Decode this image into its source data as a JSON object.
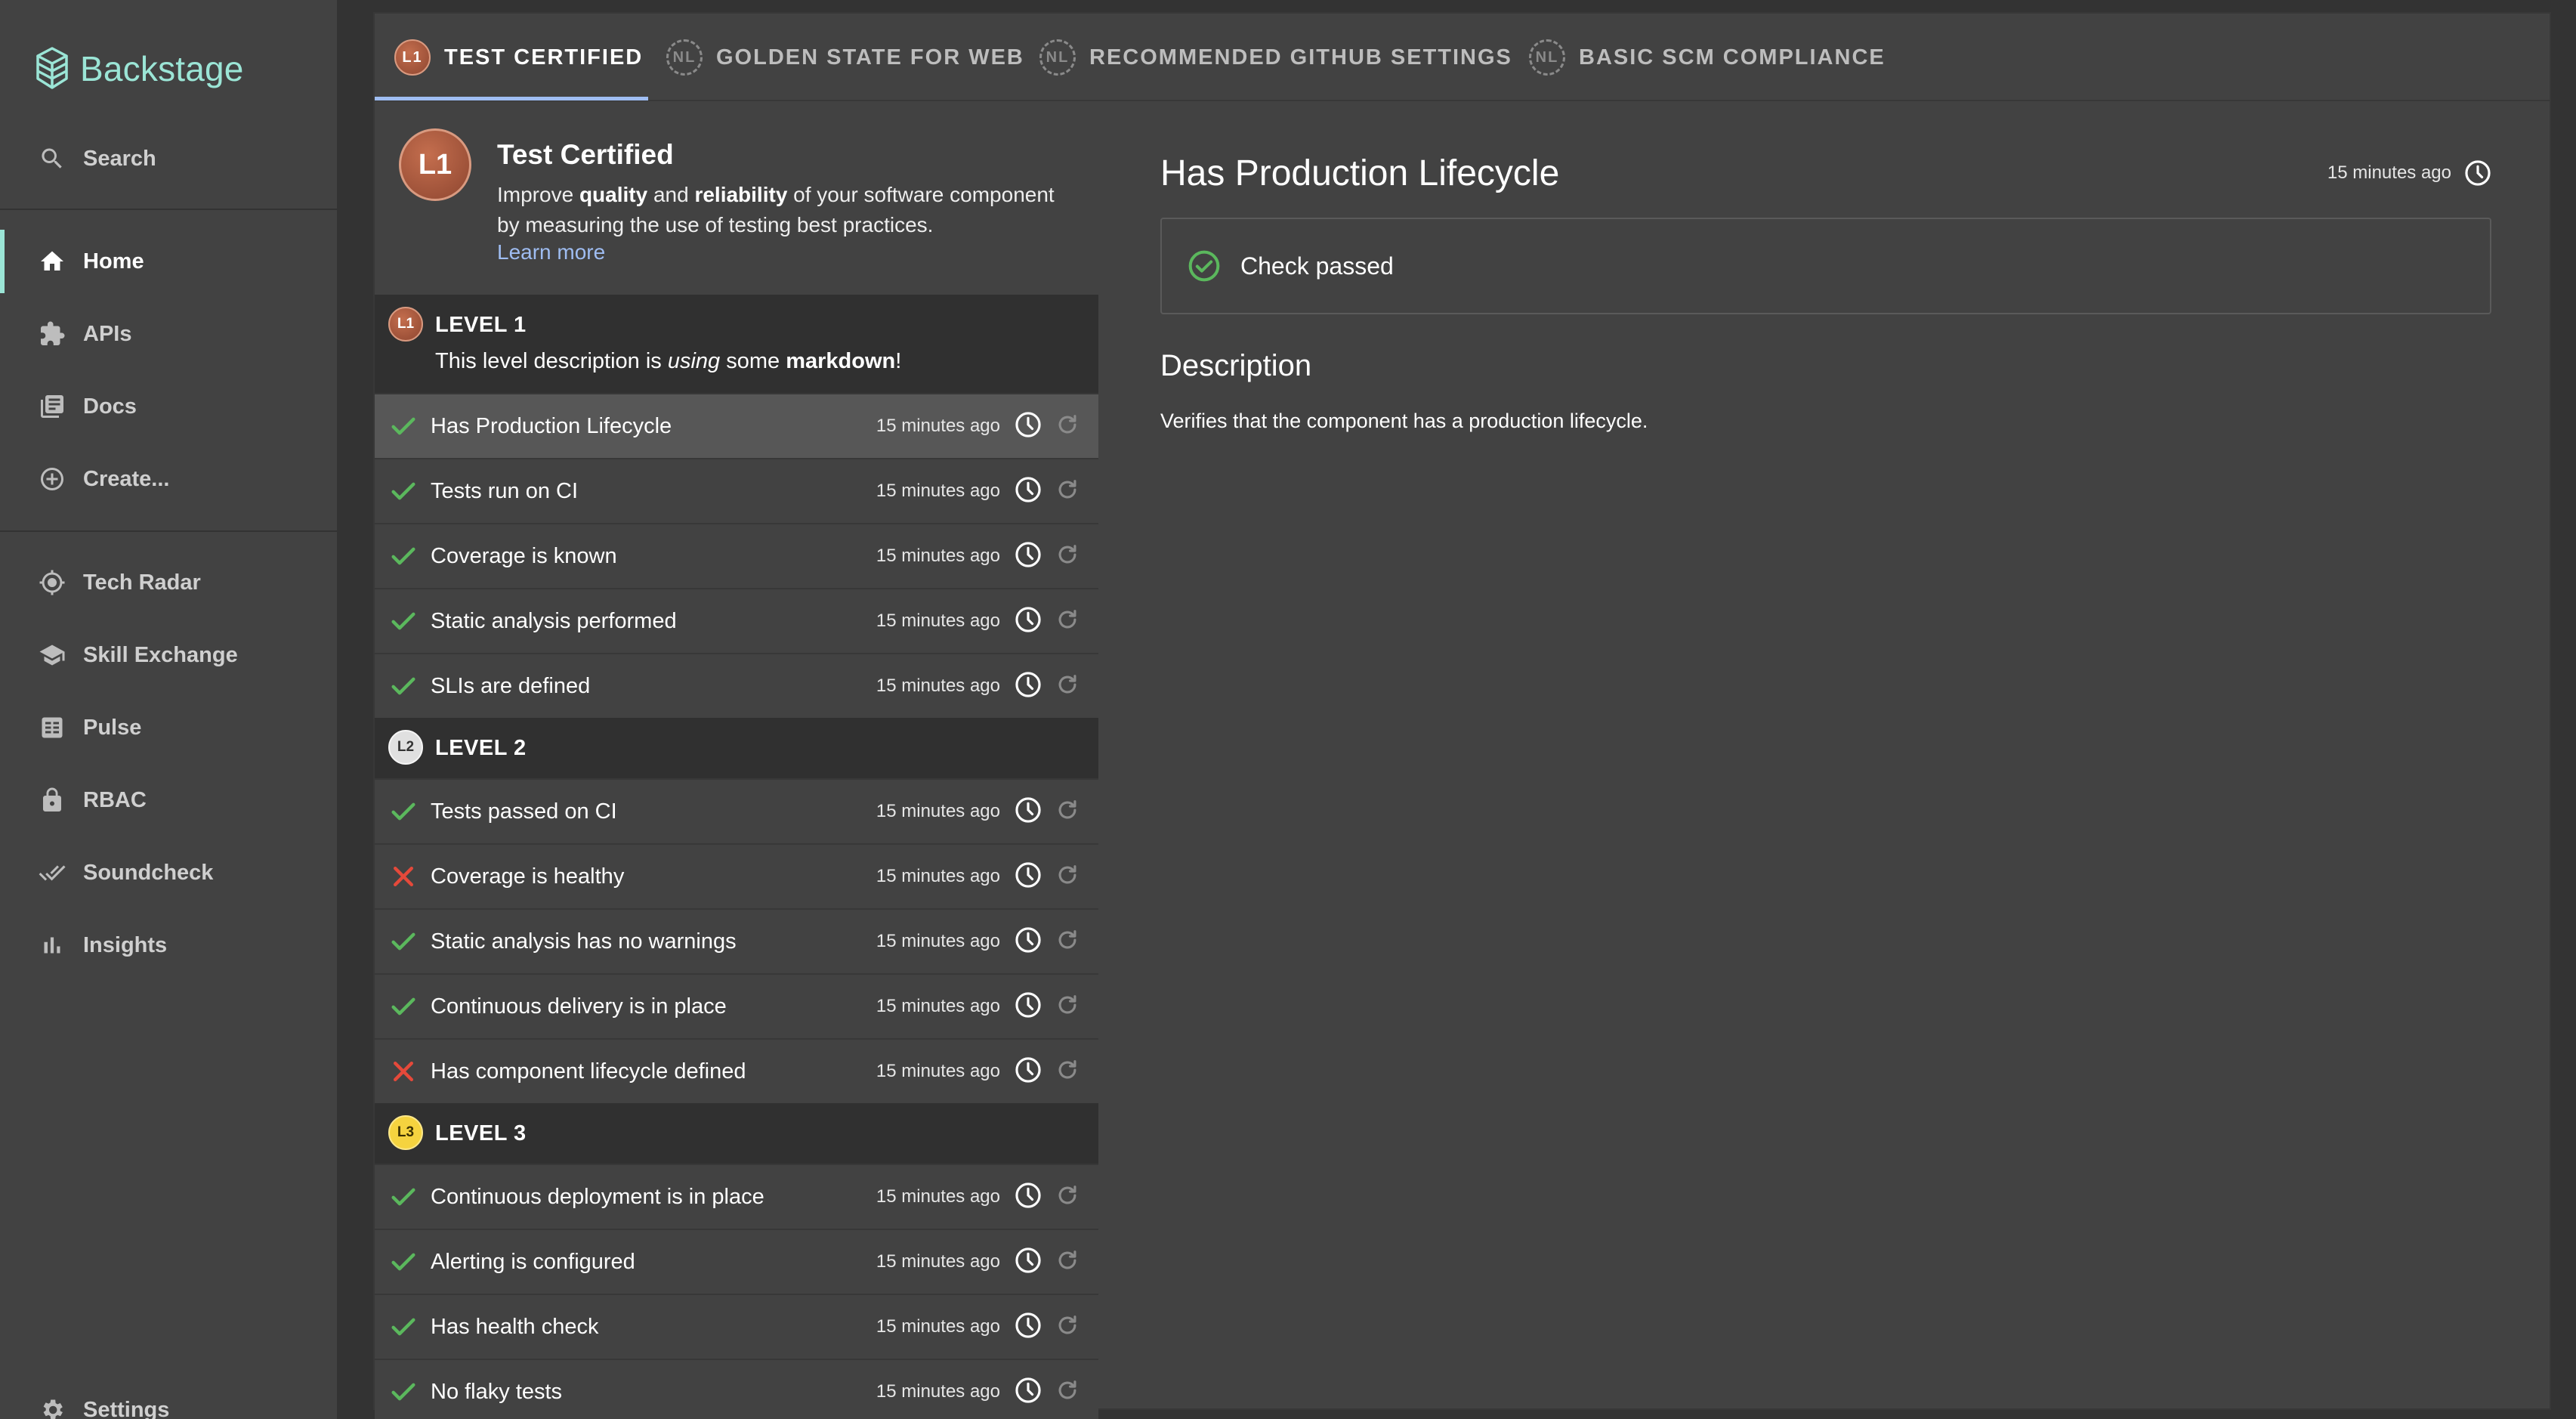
{
  "app": {
    "name": "Backstage"
  },
  "sidebar": {
    "search_label": "Search",
    "items": [
      {
        "label": "Home",
        "icon": "home-icon",
        "active": true
      },
      {
        "label": "APIs",
        "icon": "puzzle-icon"
      },
      {
        "label": "Docs",
        "icon": "docs-icon"
      },
      {
        "label": "Create...",
        "icon": "add-circle-icon"
      },
      {
        "label": "Tech Radar",
        "icon": "radar-icon"
      },
      {
        "label": "Skill Exchange",
        "icon": "school-icon"
      },
      {
        "label": "Pulse",
        "icon": "pulse-icon"
      },
      {
        "label": "RBAC",
        "icon": "lock-icon"
      },
      {
        "label": "Soundcheck",
        "icon": "double-check-icon"
      },
      {
        "label": "Insights",
        "icon": "bar-chart-icon"
      }
    ],
    "settings_label": "Settings"
  },
  "tabs": [
    {
      "badge": "L1",
      "label": "Test Certified",
      "active": true
    },
    {
      "badge": "NL",
      "label": "Golden State for Web"
    },
    {
      "badge": "NL",
      "label": "Recommended GitHub Settings"
    },
    {
      "badge": "NL",
      "label": "Basic SCM Compliance"
    }
  ],
  "certification": {
    "badge": "L1",
    "title": "Test Certified",
    "desc_1": "Improve ",
    "desc_b1": "quality",
    "desc_2": " and ",
    "desc_b2": "reliability",
    "desc_3": " of your software component by measuring the use of testing best practices.",
    "learn_more": "Learn more"
  },
  "levels": [
    {
      "badge": "L1",
      "title": "LEVEL 1",
      "desc_1": "This level description is ",
      "desc_em": "using",
      "desc_2": " some ",
      "desc_b": "markdown",
      "desc_3": "!",
      "checks": [
        {
          "name": "Has Production Lifecycle",
          "time": "15 minutes ago",
          "status": "pass"
        },
        {
          "name": "Tests run on CI",
          "time": "15 minutes ago",
          "status": "pass"
        },
        {
          "name": "Coverage is known",
          "time": "15 minutes ago",
          "status": "pass"
        },
        {
          "name": "Static analysis performed",
          "time": "15 minutes ago",
          "status": "pass"
        },
        {
          "name": "SLIs are defined",
          "time": "15 minutes ago",
          "status": "pass"
        }
      ]
    },
    {
      "badge": "L2",
      "title": "LEVEL 2",
      "checks": [
        {
          "name": "Tests passed on CI",
          "time": "15 minutes ago",
          "status": "pass"
        },
        {
          "name": "Coverage is healthy",
          "time": "15 minutes ago",
          "status": "fail"
        },
        {
          "name": "Static analysis has no warnings",
          "time": "15 minutes ago",
          "status": "pass"
        },
        {
          "name": "Continuous delivery is in place",
          "time": "15 minutes ago",
          "status": "pass"
        },
        {
          "name": "Has component lifecycle defined",
          "time": "15 minutes ago",
          "status": "fail"
        }
      ]
    },
    {
      "badge": "L3",
      "title": "LEVEL 3",
      "checks": [
        {
          "name": "Continuous deployment is in place",
          "time": "15 minutes ago",
          "status": "pass"
        },
        {
          "name": "Alerting is configured",
          "time": "15 minutes ago",
          "status": "pass"
        },
        {
          "name": "Has health check",
          "time": "15 minutes ago",
          "status": "pass"
        },
        {
          "name": "No flaky tests",
          "time": "15 minutes ago",
          "status": "pass"
        }
      ]
    }
  ],
  "detail": {
    "title": "Has Production Lifecycle",
    "time": "15 minutes ago",
    "result": "Check passed",
    "description_title": "Description",
    "description": "Verifies that the component has a production lifecycle."
  },
  "colors": {
    "accent": "#9be5d6",
    "link": "#9fbdf2",
    "pass": "#5bb85d",
    "fail": "#e5493a"
  }
}
